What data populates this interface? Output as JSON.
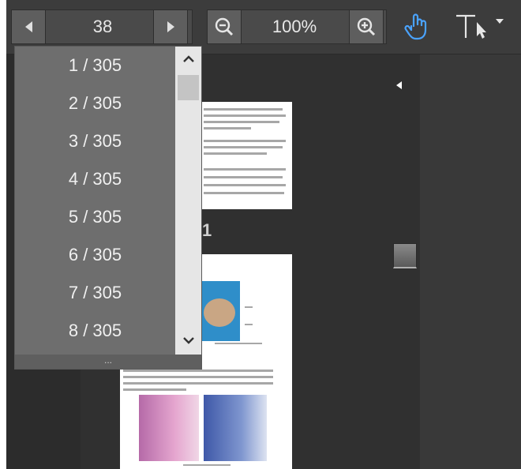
{
  "toolbar": {
    "page_number": "38",
    "zoom_level": "100%"
  },
  "dropdown": {
    "items": [
      "1 / 305",
      "2 / 305",
      "3 / 305",
      "4 / 305",
      "5 / 305",
      "6 / 305",
      "7 / 305",
      "8 / 305"
    ],
    "footer_label": "..."
  },
  "document": {
    "page_label_fragment": "1"
  },
  "icons": {
    "prev": "prev-page-icon",
    "next": "next-page-icon",
    "zoom_out": "zoom-out-icon",
    "zoom_in": "zoom-in-icon",
    "hand": "hand-tool-icon",
    "text_select": "text-select-icon"
  },
  "colors": {
    "accent": "#4aa3ff",
    "toolbar_bg": "#3c3c3c",
    "dropdown_bg": "#6e6e6e"
  }
}
